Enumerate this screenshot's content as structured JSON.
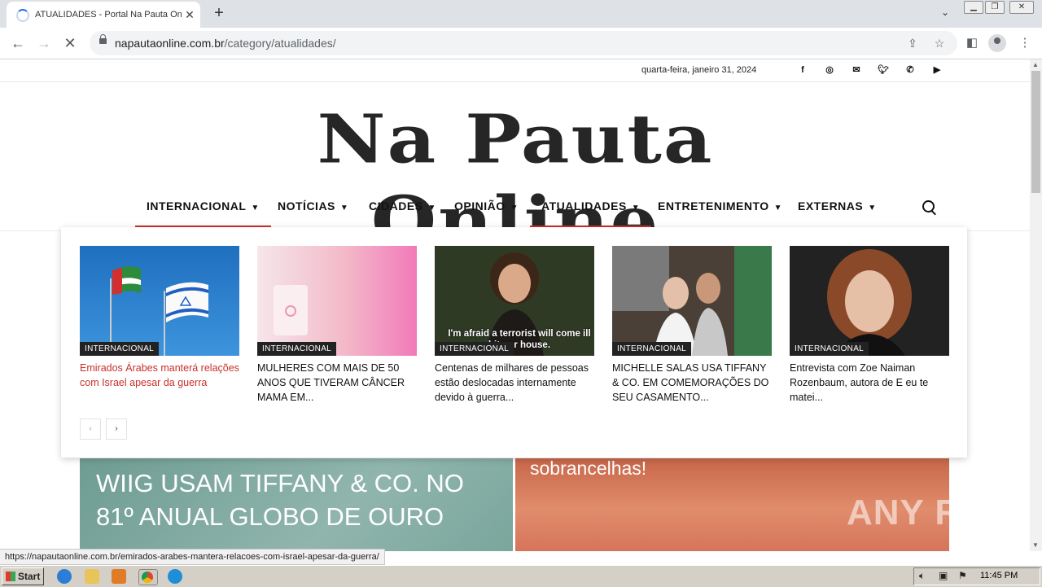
{
  "browser": {
    "tab_title": "ATUALIDADES - Portal Na Pauta Online",
    "tab_close": "✕",
    "new_tab": "+",
    "url_host": "napautaonline.com.br",
    "url_path": "/category/atualidades/",
    "back": "←",
    "forward": "→",
    "stop": "✕"
  },
  "topbar": {
    "date": "quarta-feira, janeiro 31, 2024",
    "social_icons": [
      "facebook-icon",
      "instagram-icon",
      "mail-icon",
      "twitter-icon",
      "whatsapp-icon",
      "youtube-icon"
    ]
  },
  "site": {
    "logo_text": "Na Pauta Online"
  },
  "nav": {
    "items": [
      {
        "label": "INTERNACIONAL"
      },
      {
        "label": "NOTÍCIAS"
      },
      {
        "label": "CIDADES"
      },
      {
        "label": "OPINIÃO"
      },
      {
        "label": "ATUALIDADES"
      },
      {
        "label": "ENTRETENIMENTO"
      },
      {
        "label": "EXTERNAS"
      }
    ],
    "active": [
      "INTERNACIONAL",
      "ATUALIDADES"
    ]
  },
  "megamenu": {
    "cards": [
      {
        "category": "INTERNACIONAL",
        "title": "Emirados Árabes manterá relações com Israel apesar da guerra"
      },
      {
        "category": "INTERNACIONAL",
        "title": "MULHERES COM MAIS DE 50 ANOS QUE TIVERAM CÂNCER MAMA EM..."
      },
      {
        "category": "INTERNACIONAL",
        "title": "Centenas de milhares de pessoas estão deslocadas internamente devido à guerra...",
        "caption": "I'm afraid a terrorist will come ill hit our house."
      },
      {
        "category": "INTERNACIONAL",
        "title": "MICHELLE SALAS USA TIFFANY & CO. EM COMEMORAÇÕES DO SEU CASAMENTO..."
      },
      {
        "category": "INTERNACIONAL",
        "title": "Entrevista com Zoe Naiman Rozenbaum, autora de E eu te matei..."
      }
    ],
    "prev": "‹",
    "next": "›"
  },
  "hero": {
    "left_title": "WIIG USAM TIFFANY & CO. NO 81º ANUAL GLOBO DE OURO",
    "right_title": "sobrancelhas!",
    "watermark": "ANY RUN"
  },
  "status_url": "https://napautaonline.com.br/emirados-arabes-mantera-relacoes-com-israel-apesar-da-guerra/",
  "taskbar": {
    "start": "Start",
    "clock": "11:45 PM"
  },
  "colors": {
    "accent": "#c9302c",
    "badge_bg": "#222222"
  }
}
